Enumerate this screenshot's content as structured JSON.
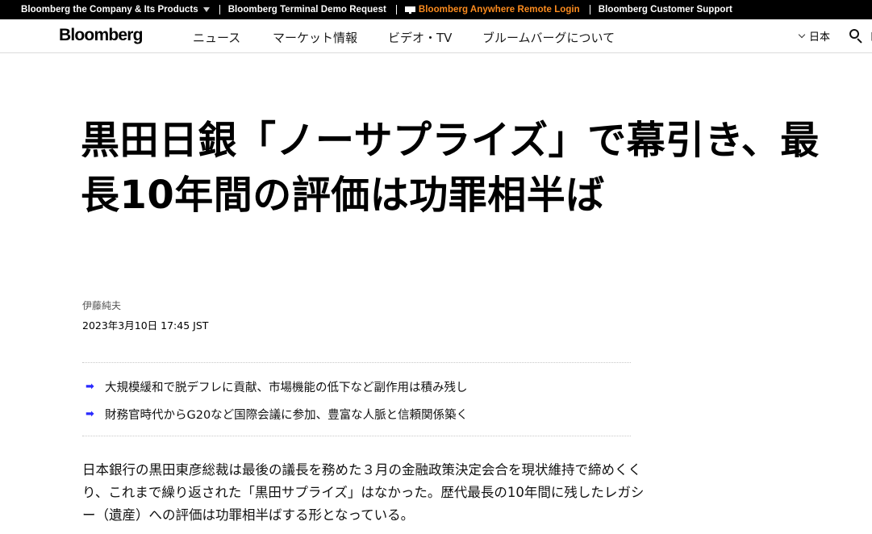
{
  "topbar": {
    "company": "Bloomberg the Company & Its Products",
    "demo": "Bloomberg Terminal Demo Request",
    "anywhere": "Bloomberg Anywhere Remote Login",
    "support": "Bloomberg Customer Support"
  },
  "nav": {
    "logo": "Bloomberg",
    "items": [
      "ニュース",
      "マーケット情報",
      "ビデオ・TV",
      "ブルームバーグについて"
    ],
    "region": "日本",
    "overflow": "ト"
  },
  "article": {
    "headline": "黒田日銀「ノーサプライズ」で幕引き、最長10年間の評価は功罪相半ば",
    "author": "伊藤純夫",
    "timestamp": "2023年3月10日 17:45 JST",
    "summary": [
      "大規模緩和で脱デフレに貢献、市場機能の低下など副作用は積み残し",
      "財務官時代からG20など国際会議に参加、豊富な人脈と信頼関係築く"
    ],
    "summary_arrow": "➡",
    "body": "日本銀行の黒田東彦総裁は最後の議長を務めた３月の金融政策決定会合を現状維持で締めくくり、これまで繰り返された「黒田サプライズ」はなかった。歴代最長の10年間に残したレガシー（遺産）への評価は功罪相半ばする形となっている。"
  },
  "colors": {
    "topbar_bg": "#000000",
    "accent": "#fb8b1e",
    "arrow": "#2a2aff"
  },
  "icons": [
    "caret-down-icon",
    "terminal-icon",
    "chevron-down-icon",
    "search-icon",
    "arrow-right-icon"
  ]
}
